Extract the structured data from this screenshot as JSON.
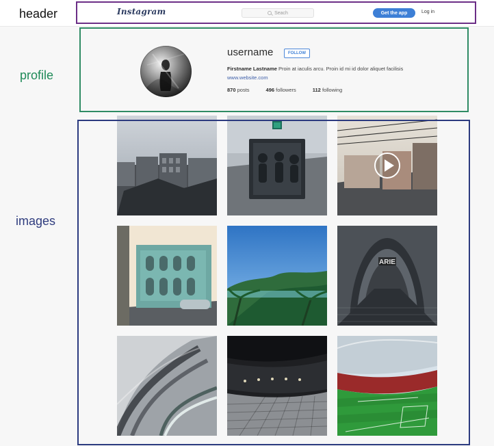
{
  "annotations": {
    "header": "header",
    "profile": "profile",
    "images": "images"
  },
  "header": {
    "logo": "Instagram",
    "search_placeholder": "Seach",
    "get_app_label": "Get the app",
    "login_label": "Log in",
    "icons": {
      "search": "search-icon"
    }
  },
  "profile": {
    "username": "username",
    "follow_label": "FOLLOW",
    "bio_name": "Firstname Lastname",
    "bio_text": "Proin at iaculis arcu. Proin id mi id dolor aliquet facilisis",
    "website": "www.website.com",
    "stats": {
      "posts": {
        "count": "870",
        "label": "posts"
      },
      "followers": {
        "count": "496",
        "label": "followers"
      },
      "following": {
        "count": "112",
        "label": "following"
      }
    }
  },
  "images": {
    "grid": [
      {
        "kind": "city-rooftops"
      },
      {
        "kind": "truck-riders"
      },
      {
        "kind": "street-video",
        "has_video_icon": true
      },
      {
        "kind": "colonial-building"
      },
      {
        "kind": "bay-palms"
      },
      {
        "kind": "tunnel-arie"
      },
      {
        "kind": "curved-architecture"
      },
      {
        "kind": "train-platform"
      },
      {
        "kind": "stadium-pitch"
      }
    ],
    "tunnel_text": "ARIE"
  },
  "colors": {
    "accent_blue": "#3d7fd6",
    "header_frame": "#6b2d86",
    "profile_frame": "#2f8b64",
    "images_frame": "#2b3a7f"
  }
}
